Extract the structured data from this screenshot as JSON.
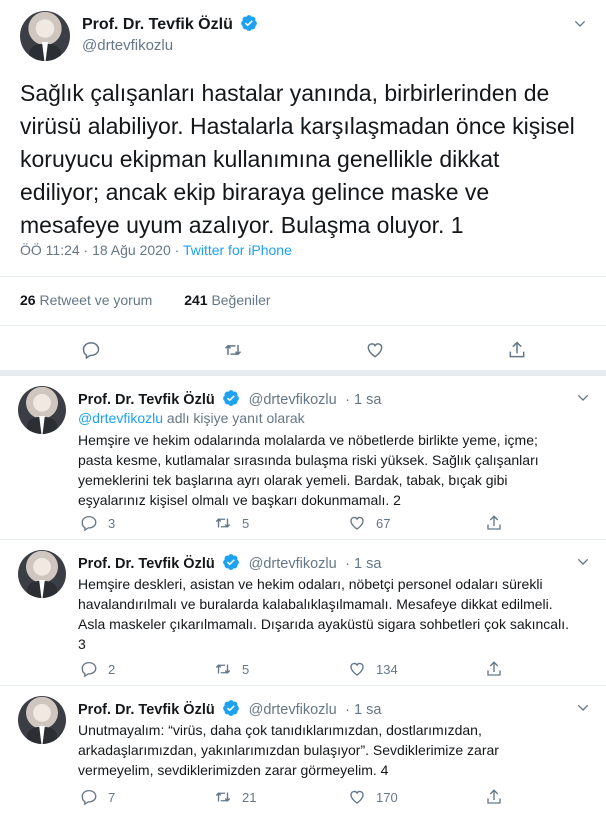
{
  "main_tweet": {
    "author_name": "Prof. Dr. Tevfik Özlü",
    "author_handle": "@drtevfikozlu",
    "text": "Sağlık çalışanları hastalar yanında,  birbirlerinden de virüsü alabiliyor. Hastalarla karşılaşmadan önce kişisel koruyucu ekipman kullanımına genellikle dikkat ediliyor; ancak ekip biraraya gelince maske ve mesafeye uyum azalıyor. Bulaşma oluyor. 1",
    "time": "ÖÖ 11:24 · 18 Ağu 2020 ·",
    "source": "Twitter for iPhone",
    "retweets_count": "26",
    "retweets_label": "Retweet ve yorum",
    "likes_count": "241",
    "likes_label": "Beğeniler"
  },
  "replies": [
    {
      "author_name": "Prof. Dr. Tevfik Özlü",
      "author_handle": "@drtevfikozlu",
      "time": "· 1 sa",
      "replying_mention": "@drtevfikozlu",
      "replying_label": "adlı kişiye yanıt olarak",
      "lines": [
        "Hemşire ve hekim odalarında molalarda ve nöbetlerde birlikte yeme, içme;",
        "pasta kesme, kutlamalar sırasında bulaşma riski yüksek. Sağlık çalışanları",
        "yemeklerini tek başlarına ayrı olarak yemeli. Bardak, tabak, bıçak gibi",
        "eşyalarınız kişisel olmalı ve başkarı dokunmamalı. 2"
      ],
      "reply_count": "3",
      "retweet_count": "5",
      "like_count": "67"
    },
    {
      "author_name": "Prof. Dr. Tevfik Özlü",
      "author_handle": "@drtevfikozlu",
      "time": "· 1 sa",
      "lines": [
        "Hemşire deskleri, asistan ve hekim odaları, nöbetçi personel odaları sürekli",
        "havalandırılmalı ve buralarda kalabalıklaşılmamalı. Mesafeye dikkat edilmeli.",
        "Asla maskeler çıkarılmamalı. Dışarıda ayaküstü sigara sohbetleri çok sakıncalı.",
        "3"
      ],
      "reply_count": "2",
      "retweet_count": "5",
      "like_count": "134"
    },
    {
      "author_name": "Prof. Dr. Tevfik Özlü",
      "author_handle": "@drtevfikozlu",
      "time": "· 1 sa",
      "lines": [
        "Unutmayalım: “virüs, daha çok tanıdıklarımızdan, dostlarımızdan,",
        "arkadaşlarımızdan, yakınlarımızdan bulaşıyor”. Sevdiklerimize zarar",
        "vermeyelim, sevdiklerimizden zarar görmeyelim. 4"
      ],
      "reply_count": "7",
      "retweet_count": "21",
      "like_count": "170"
    }
  ],
  "colors": {
    "accent": "#1da1f2",
    "text": "#14171a",
    "muted": "#657786",
    "divider": "#e6ecf0"
  },
  "icons": [
    "verified-badge-icon",
    "chevron-down-icon",
    "reply-icon",
    "retweet-icon",
    "like-icon",
    "share-icon"
  ]
}
